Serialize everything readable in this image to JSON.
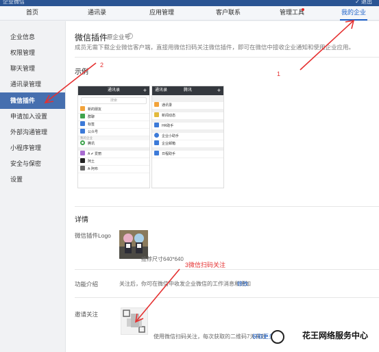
{
  "topbar": {
    "brand": "企业微信",
    "right_text": "✓ 退出"
  },
  "nav": {
    "items": [
      {
        "label": "首页"
      },
      {
        "label": "通讯录"
      },
      {
        "label": "应用管理"
      },
      {
        "label": "客户联系"
      },
      {
        "label": "管理工具"
      },
      {
        "label": "我的企业"
      }
    ],
    "active_index": 5
  },
  "sidebar": {
    "items": [
      {
        "label": "企业信息"
      },
      {
        "label": "权限管理"
      },
      {
        "label": "聊天管理"
      },
      {
        "label": "通讯录管理"
      },
      {
        "label": "微信插件"
      },
      {
        "label": "申请加入设置"
      },
      {
        "label": "外部沟通管理"
      },
      {
        "label": "小程序管理"
      },
      {
        "label": "安全与保密"
      },
      {
        "label": "设置"
      }
    ],
    "active_index": 4
  },
  "main": {
    "title": "微信插件",
    "title_tag": "原企业号",
    "info_icon": "?",
    "description": "成员无需下载企业微信客户端，直接用微信扫码关注微信插件，即可在微信中接收企业通知和使用企业应用。",
    "example_label": "示例",
    "phone1": {
      "title": "通讯录",
      "add": "+",
      "search": "搜索",
      "rows": [
        "新的朋友",
        "群聊",
        "标签",
        "公众号"
      ],
      "sub": "我的企业",
      "rows2": [
        "腾讯"
      ],
      "rows3": [
        "A  ✔ 爱丽",
        "阿土",
        "A·阿布"
      ]
    },
    "phone2": {
      "back": "通讯录",
      "title": "腾讯",
      "add": "+",
      "rows": [
        "通讯录",
        "新闻动态",
        "HR助手",
        "企业小助手",
        "企业邮箱",
        "日程助手"
      ]
    },
    "details_label": "详情",
    "logo_label": "微信插件Logo",
    "logo_hint": "推荐尺寸640*640",
    "intro_label": "功能介绍",
    "intro_text": "关注后，你可在微信中收发企业微信的工作消息和通知",
    "intro_edit": "修改",
    "invite_label": "邀请关注",
    "invite_text": "使用微信扫码关注，每次获取的二维码7天有效",
    "invite_link": "获取更多R"
  },
  "annotations": {
    "a1": "1",
    "a2": "2",
    "a3": "3微信扫码关注"
  },
  "watermark": "花王网络服务中心",
  "colors": {
    "accent": "#1c60c9",
    "sidebar_active": "#466faf",
    "topbar": "#2a5493",
    "annotation": "#e53030"
  }
}
